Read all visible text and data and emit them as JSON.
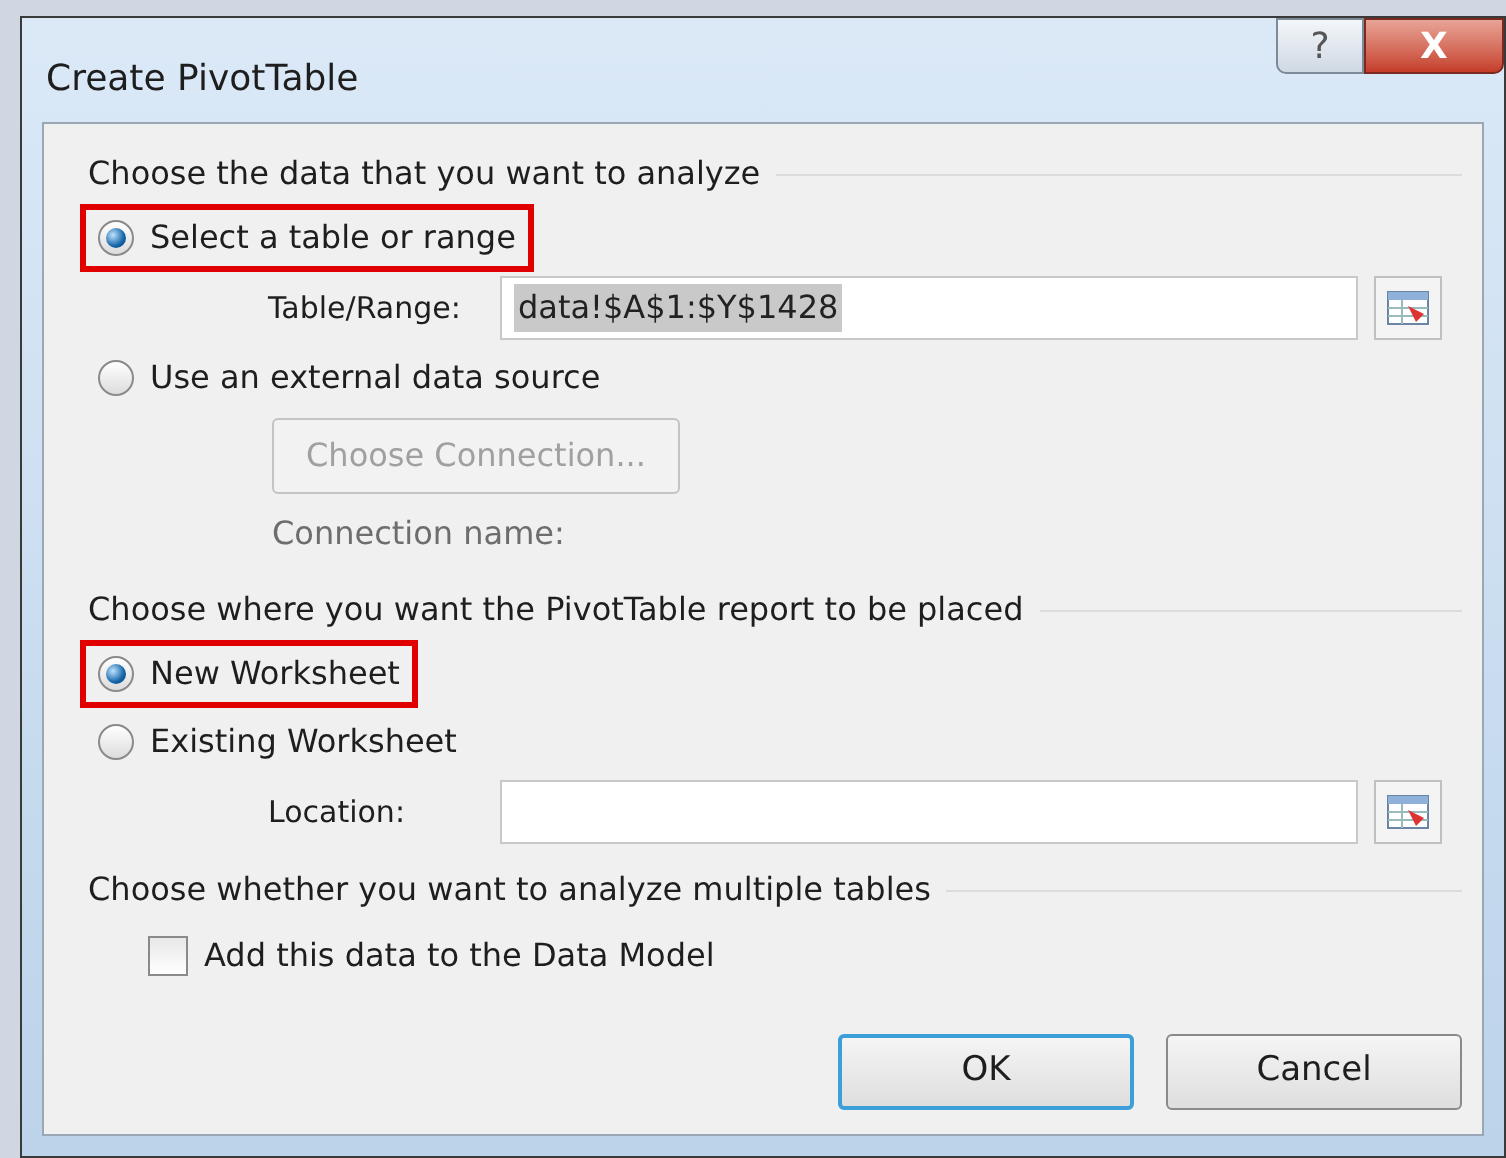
{
  "window": {
    "title": "Create PivotTable",
    "buttons": [
      {
        "kind": "help",
        "label": "?"
      },
      {
        "kind": "close",
        "label": "X"
      }
    ]
  },
  "sections": [
    {
      "heading": "Choose the data that you want to analyze",
      "items": [
        {
          "kind": "radio",
          "label": "Select a table or range",
          "selected": true,
          "highlighted": true
        },
        {
          "kind": "field",
          "label": "Table/Range:",
          "value": "data!$A$1:$Y$1428",
          "text_selected": true
        },
        {
          "kind": "radio",
          "label": "Use an external data source",
          "selected": false,
          "highlighted": false
        },
        {
          "kind": "button",
          "label": "Choose Connection...",
          "disabled": true
        },
        {
          "kind": "note",
          "label": "Connection name:"
        }
      ]
    },
    {
      "heading": "Choose where you want the PivotTable report to be placed",
      "items": [
        {
          "kind": "radio",
          "label": "New Worksheet",
          "selected": true,
          "highlighted": true
        },
        {
          "kind": "radio",
          "label": "Existing Worksheet",
          "selected": false,
          "highlighted": false
        },
        {
          "kind": "field",
          "label": "Location:",
          "value": ""
        }
      ]
    },
    {
      "heading": "Choose whether you want to analyze multiple tables",
      "items": [
        {
          "kind": "checkbox",
          "label": "Add this data to the Data Model",
          "checked": false
        }
      ]
    }
  ],
  "buttons": [
    {
      "label": "OK",
      "default": true
    },
    {
      "label": "Cancel",
      "default": false
    }
  ]
}
